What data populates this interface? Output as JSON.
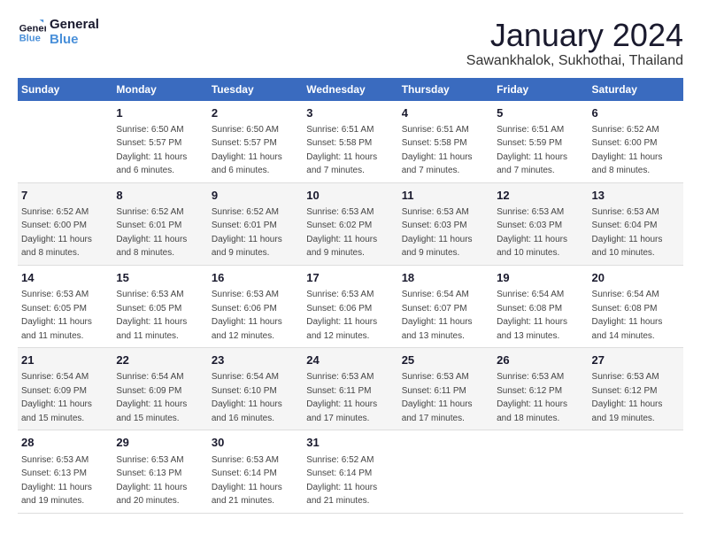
{
  "logo": {
    "line1": "General",
    "line2": "Blue"
  },
  "title": "January 2024",
  "subtitle": "Sawankhalok, Sukhothai, Thailand",
  "days_header": [
    "Sunday",
    "Monday",
    "Tuesday",
    "Wednesday",
    "Thursday",
    "Friday",
    "Saturday"
  ],
  "weeks": [
    [
      {
        "num": "",
        "info": ""
      },
      {
        "num": "1",
        "info": "Sunrise: 6:50 AM\nSunset: 5:57 PM\nDaylight: 11 hours\nand 6 minutes."
      },
      {
        "num": "2",
        "info": "Sunrise: 6:50 AM\nSunset: 5:57 PM\nDaylight: 11 hours\nand 6 minutes."
      },
      {
        "num": "3",
        "info": "Sunrise: 6:51 AM\nSunset: 5:58 PM\nDaylight: 11 hours\nand 7 minutes."
      },
      {
        "num": "4",
        "info": "Sunrise: 6:51 AM\nSunset: 5:58 PM\nDaylight: 11 hours\nand 7 minutes."
      },
      {
        "num": "5",
        "info": "Sunrise: 6:51 AM\nSunset: 5:59 PM\nDaylight: 11 hours\nand 7 minutes."
      },
      {
        "num": "6",
        "info": "Sunrise: 6:52 AM\nSunset: 6:00 PM\nDaylight: 11 hours\nand 8 minutes."
      }
    ],
    [
      {
        "num": "7",
        "info": "Sunrise: 6:52 AM\nSunset: 6:00 PM\nDaylight: 11 hours\nand 8 minutes."
      },
      {
        "num": "8",
        "info": "Sunrise: 6:52 AM\nSunset: 6:01 PM\nDaylight: 11 hours\nand 8 minutes."
      },
      {
        "num": "9",
        "info": "Sunrise: 6:52 AM\nSunset: 6:01 PM\nDaylight: 11 hours\nand 9 minutes."
      },
      {
        "num": "10",
        "info": "Sunrise: 6:53 AM\nSunset: 6:02 PM\nDaylight: 11 hours\nand 9 minutes."
      },
      {
        "num": "11",
        "info": "Sunrise: 6:53 AM\nSunset: 6:03 PM\nDaylight: 11 hours\nand 9 minutes."
      },
      {
        "num": "12",
        "info": "Sunrise: 6:53 AM\nSunset: 6:03 PM\nDaylight: 11 hours\nand 10 minutes."
      },
      {
        "num": "13",
        "info": "Sunrise: 6:53 AM\nSunset: 6:04 PM\nDaylight: 11 hours\nand 10 minutes."
      }
    ],
    [
      {
        "num": "14",
        "info": "Sunrise: 6:53 AM\nSunset: 6:05 PM\nDaylight: 11 hours\nand 11 minutes."
      },
      {
        "num": "15",
        "info": "Sunrise: 6:53 AM\nSunset: 6:05 PM\nDaylight: 11 hours\nand 11 minutes."
      },
      {
        "num": "16",
        "info": "Sunrise: 6:53 AM\nSunset: 6:06 PM\nDaylight: 11 hours\nand 12 minutes."
      },
      {
        "num": "17",
        "info": "Sunrise: 6:53 AM\nSunset: 6:06 PM\nDaylight: 11 hours\nand 12 minutes."
      },
      {
        "num": "18",
        "info": "Sunrise: 6:54 AM\nSunset: 6:07 PM\nDaylight: 11 hours\nand 13 minutes."
      },
      {
        "num": "19",
        "info": "Sunrise: 6:54 AM\nSunset: 6:08 PM\nDaylight: 11 hours\nand 13 minutes."
      },
      {
        "num": "20",
        "info": "Sunrise: 6:54 AM\nSunset: 6:08 PM\nDaylight: 11 hours\nand 14 minutes."
      }
    ],
    [
      {
        "num": "21",
        "info": "Sunrise: 6:54 AM\nSunset: 6:09 PM\nDaylight: 11 hours\nand 15 minutes."
      },
      {
        "num": "22",
        "info": "Sunrise: 6:54 AM\nSunset: 6:09 PM\nDaylight: 11 hours\nand 15 minutes."
      },
      {
        "num": "23",
        "info": "Sunrise: 6:54 AM\nSunset: 6:10 PM\nDaylight: 11 hours\nand 16 minutes."
      },
      {
        "num": "24",
        "info": "Sunrise: 6:53 AM\nSunset: 6:11 PM\nDaylight: 11 hours\nand 17 minutes."
      },
      {
        "num": "25",
        "info": "Sunrise: 6:53 AM\nSunset: 6:11 PM\nDaylight: 11 hours\nand 17 minutes."
      },
      {
        "num": "26",
        "info": "Sunrise: 6:53 AM\nSunset: 6:12 PM\nDaylight: 11 hours\nand 18 minutes."
      },
      {
        "num": "27",
        "info": "Sunrise: 6:53 AM\nSunset: 6:12 PM\nDaylight: 11 hours\nand 19 minutes."
      }
    ],
    [
      {
        "num": "28",
        "info": "Sunrise: 6:53 AM\nSunset: 6:13 PM\nDaylight: 11 hours\nand 19 minutes."
      },
      {
        "num": "29",
        "info": "Sunrise: 6:53 AM\nSunset: 6:13 PM\nDaylight: 11 hours\nand 20 minutes."
      },
      {
        "num": "30",
        "info": "Sunrise: 6:53 AM\nSunset: 6:14 PM\nDaylight: 11 hours\nand 21 minutes."
      },
      {
        "num": "31",
        "info": "Sunrise: 6:52 AM\nSunset: 6:14 PM\nDaylight: 11 hours\nand 21 minutes."
      },
      {
        "num": "",
        "info": ""
      },
      {
        "num": "",
        "info": ""
      },
      {
        "num": "",
        "info": ""
      }
    ]
  ]
}
